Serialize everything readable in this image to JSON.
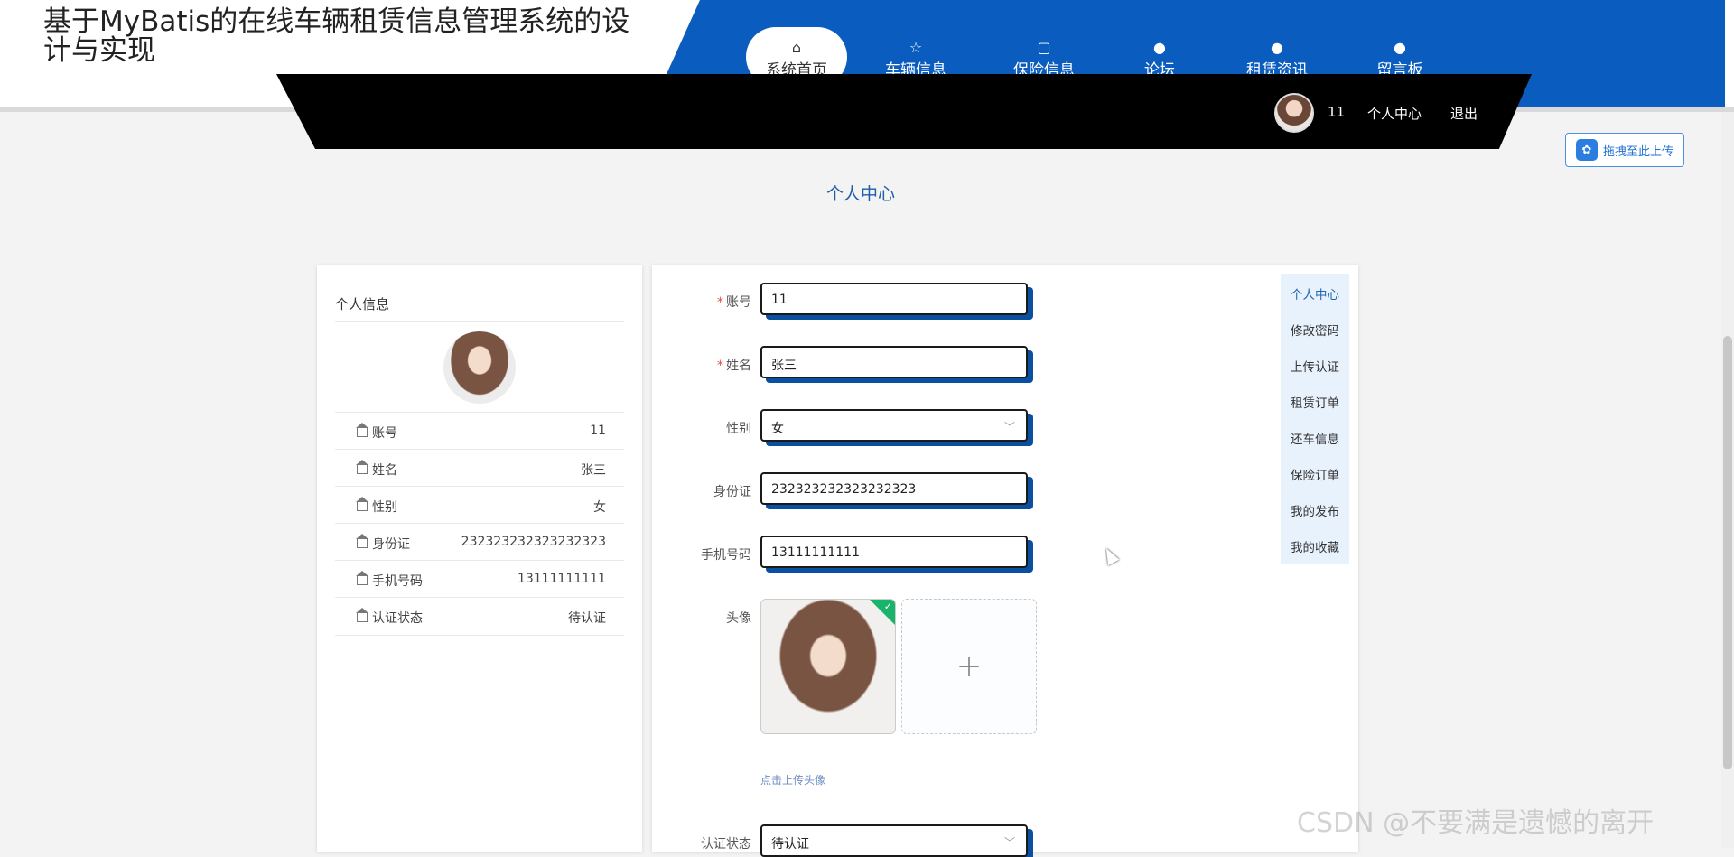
{
  "site_title": "基于MyBatis的在线车辆租赁信息管理系统的设计与实现",
  "nav": [
    {
      "label": "系统首页",
      "icon": "home-icon",
      "glyph": "⌂"
    },
    {
      "label": "车辆信息",
      "icon": "star-icon",
      "glyph": "☆"
    },
    {
      "label": "保险信息",
      "icon": "bag-icon",
      "glyph": "▢"
    },
    {
      "label": "论坛",
      "icon": "exclamation-icon",
      "glyph": "●"
    },
    {
      "label": "租赁资讯",
      "icon": "question-icon",
      "glyph": "●"
    },
    {
      "label": "留言板",
      "icon": "info-icon",
      "glyph": "●"
    }
  ],
  "user": {
    "name": "11",
    "center_link": "个人中心",
    "logout": "退出"
  },
  "upload_drag": "拖拽至此上传",
  "page_title": "个人中心",
  "info_card": {
    "heading": "个人信息",
    "rows": [
      {
        "label": "账号",
        "value": "11"
      },
      {
        "label": "姓名",
        "value": "张三"
      },
      {
        "label": "性别",
        "value": "女"
      },
      {
        "label": "身份证",
        "value": "232323232323232323"
      },
      {
        "label": "手机号码",
        "value": "13111111111"
      },
      {
        "label": "认证状态",
        "value": "待认证"
      }
    ]
  },
  "form": {
    "account_label": "账号",
    "account_value": "11",
    "name_label": "姓名",
    "name_value": "张三",
    "gender_label": "性别",
    "gender_value": "女",
    "id_label": "身份证",
    "id_value": "232323232323232323",
    "phone_label": "手机号码",
    "phone_value": "13111111111",
    "avatar_label": "头像",
    "upload_hint": "点击上传头像",
    "status_label": "认证状态",
    "status_value": "待认证"
  },
  "side_menu": [
    {
      "label": "个人中心",
      "active": true
    },
    {
      "label": "修改密码"
    },
    {
      "label": "上传认证"
    },
    {
      "label": "租赁订单"
    },
    {
      "label": "还车信息"
    },
    {
      "label": "保险订单"
    },
    {
      "label": "我的发布"
    },
    {
      "label": "我的收藏"
    }
  ],
  "watermark": "CSDN @不要满是遗憾的离开",
  "colors": {
    "primary": "#0a5dbe",
    "accent": "#1e5fa8",
    "success": "#19b36b"
  }
}
